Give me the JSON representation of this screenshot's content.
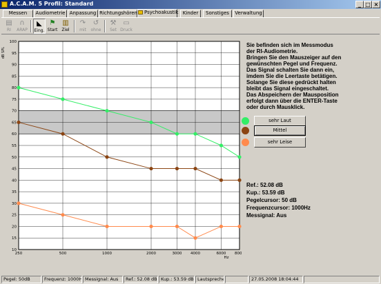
{
  "window": {
    "title": "A.C.A.M. 5 Profil: Standard"
  },
  "tabs": [
    {
      "label": "Messen"
    },
    {
      "label": "Audiometrie"
    },
    {
      "label": "Anpassung"
    },
    {
      "label": "Richtungshören"
    },
    {
      "label": "Psychoakustik",
      "active": true
    },
    {
      "label": "Kinder"
    },
    {
      "label": "Sonstiges"
    },
    {
      "label": "Verwaltung"
    }
  ],
  "toolbar": [
    {
      "label": "RI",
      "icon": "ri-icon",
      "enabled": false
    },
    {
      "label": "ARAP",
      "icon": "arap-icon",
      "enabled": false
    },
    {
      "label": "Eing.",
      "icon": "input-icon",
      "enabled": true,
      "pressed": true
    },
    {
      "label": "Start",
      "icon": "start-icon",
      "enabled": true
    },
    {
      "label": "Ziel",
      "icon": "target-icon",
      "enabled": true
    },
    {
      "label": "mit",
      "icon": "with-icon",
      "enabled": false
    },
    {
      "label": "ohne",
      "icon": "without-icon",
      "enabled": false
    },
    {
      "label": "Set",
      "icon": "tools-icon",
      "enabled": false
    },
    {
      "label": "Druck",
      "icon": "print-icon",
      "enabled": false
    }
  ],
  "instructions": "Sie befinden sich im Messmodus\nder RI-Audiometrie.\nBringen Sie den Mauszeiger auf den\ngewünschten Pegel und Frequenz.\nDas Signal schalten Sie dann ein,\nimdem Sie die Leertaste betätigen.\nSolange Sie diese gedrückt halten\nbleibt das Signal eingeschaltet.\nDas Abspeichern der Mausposition\nerfolgt dann über die ENTER-Taste\noder durch Mausklick.",
  "levels": [
    {
      "label": "sehr Laut",
      "color": "#33ee66",
      "selected": false
    },
    {
      "label": "Mittel",
      "color": "#8b4513",
      "selected": true
    },
    {
      "label": "sehr Leise",
      "color": "#ff8a4c",
      "selected": false
    }
  ],
  "readouts": {
    "ref": "Ref.: 52.08 dB",
    "kup": "Kup.: 53.59 dB",
    "pegelcursor": "Pegelcursor: 50 dB",
    "freqcursor": "Frequenzcursor: 1000Hz",
    "messignal": "Messignal: Aus"
  },
  "statusbar": [
    "Pegel: 50dB",
    "Frequenz: 1000Hz",
    "Messignal: Aus",
    "Ref.: 52.08 dB",
    "Kup.: 53.59 dB",
    "Lautsprecher",
    "",
    "27.05.2008 18:04:44",
    ""
  ],
  "chart_data": {
    "type": "line",
    "ylabel": "dB SPL",
    "xlabel": "Hz",
    "x_scale": "log",
    "categories": [
      250,
      500,
      1000,
      2000,
      3000,
      4000,
      6000,
      8000
    ],
    "tick_labels": [
      "250",
      "500",
      "1000",
      "2000",
      "3000",
      "4000",
      "6000",
      "8000"
    ],
    "ylim": [
      10,
      100
    ],
    "ytick_step": 5,
    "grid": true,
    "reference_band": [
      60,
      70
    ],
    "series": [
      {
        "values": [
          80,
          75,
          70,
          65,
          60,
          60,
          55,
          50
        ],
        "color": "#33ee66"
      },
      {
        "values": [
          65,
          60,
          50,
          45,
          45,
          45,
          40,
          40
        ],
        "color": "#8b4513"
      },
      {
        "values": [
          30,
          25,
          20,
          20,
          20,
          15,
          20,
          20
        ],
        "color": "#ff8a4c"
      }
    ]
  }
}
